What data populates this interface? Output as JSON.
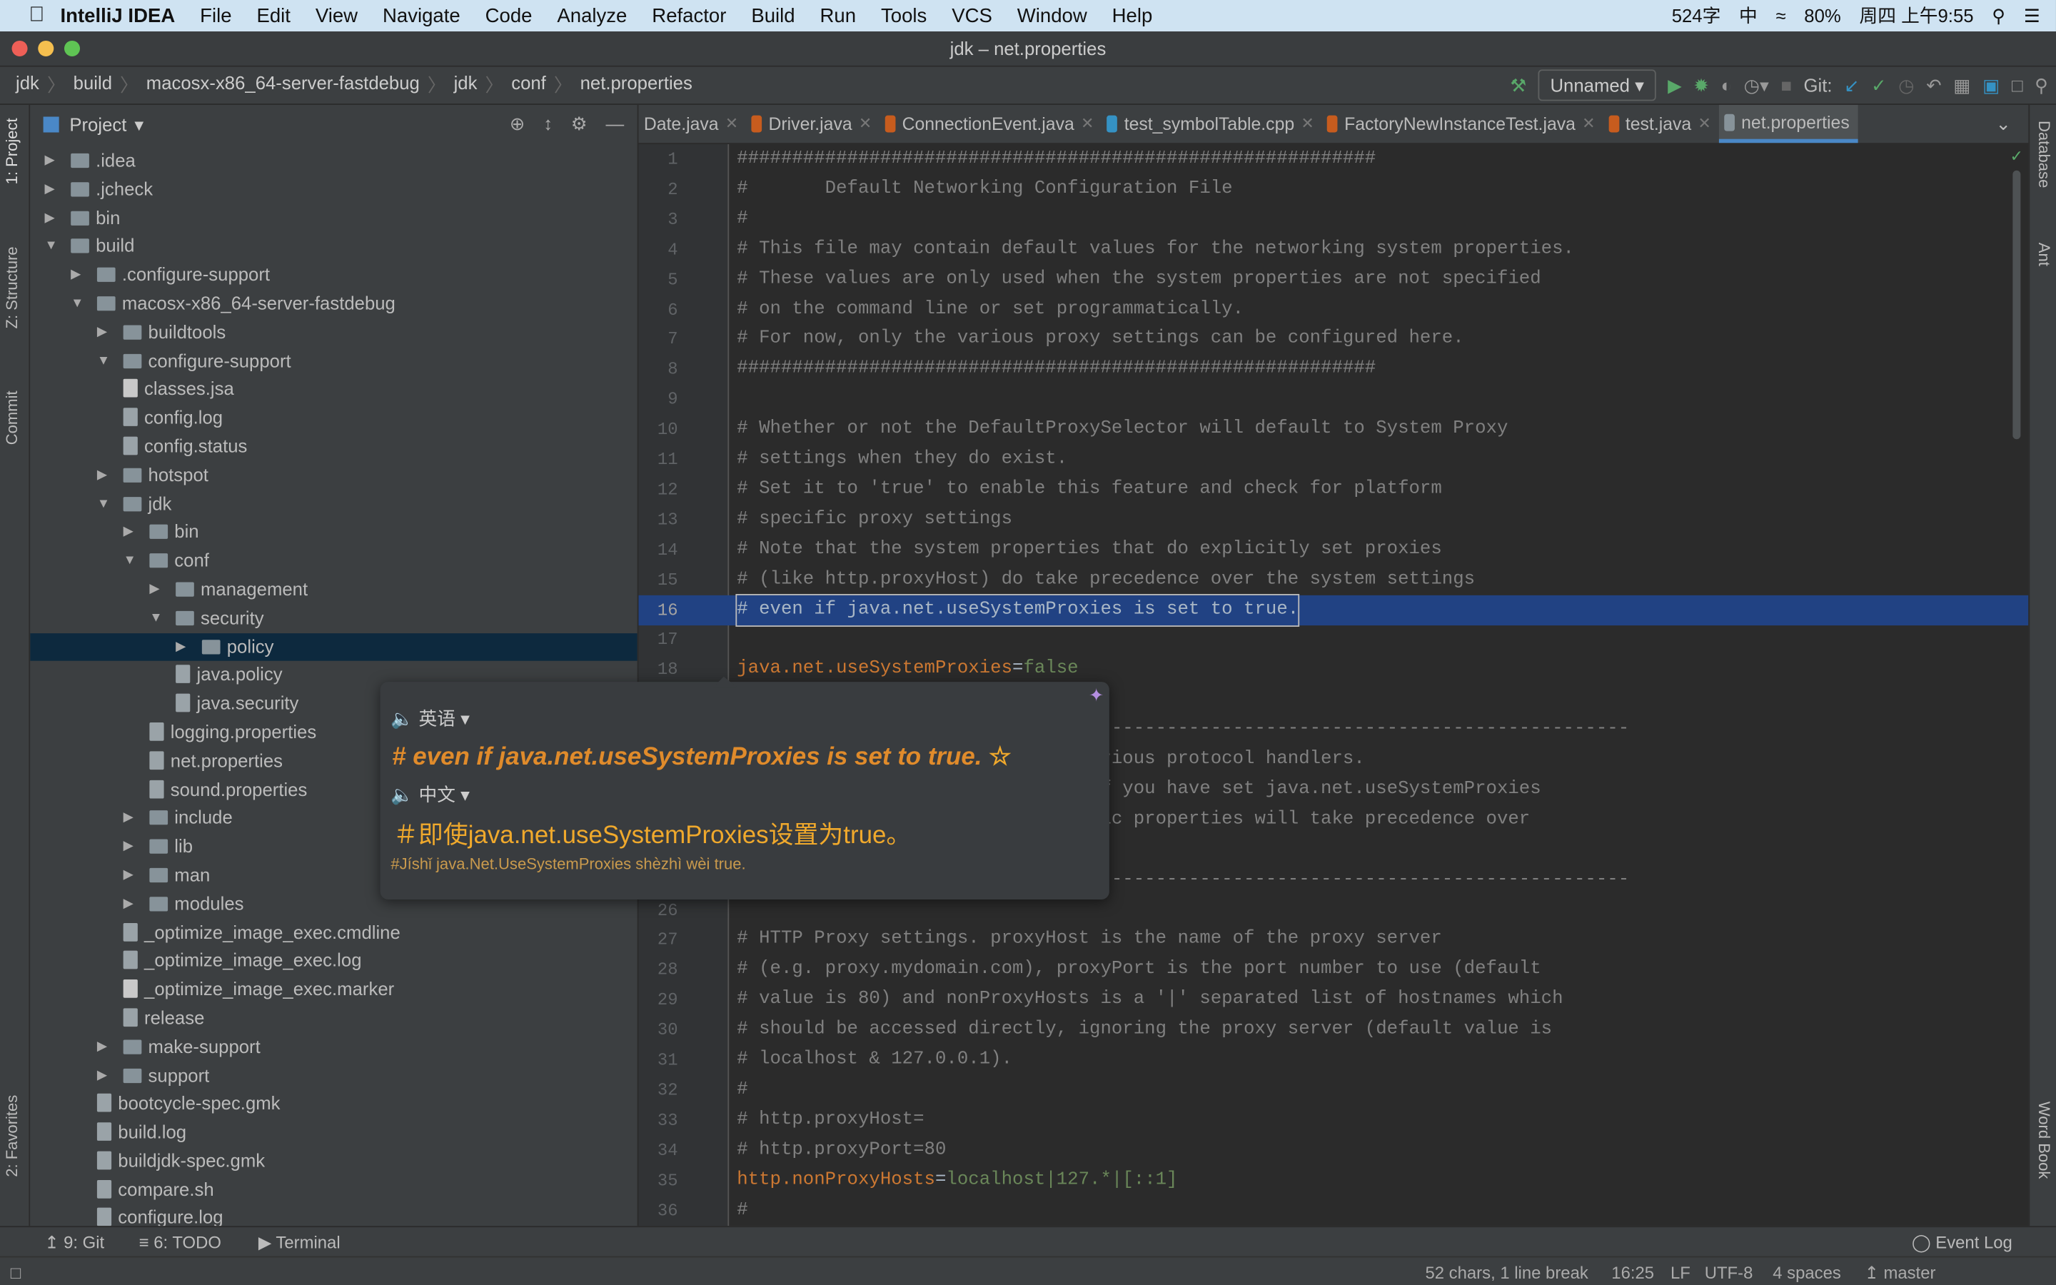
{
  "menubar": {
    "app": "IntelliJ IDEA",
    "items": [
      "File",
      "Edit",
      "View",
      "Navigate",
      "Code",
      "Analyze",
      "Refactor",
      "Build",
      "Run",
      "Tools",
      "VCS",
      "Window",
      "Help"
    ],
    "status": {
      "word_count": "524字",
      "input": "中",
      "battery": "80%",
      "clock": "周四 上午9:55"
    }
  },
  "window": {
    "title": "jdk – net.properties"
  },
  "breadcrumb": [
    "jdk",
    "build",
    "macosx-x86_64-server-fastdebug",
    "jdk",
    "conf",
    "net.properties"
  ],
  "toolbar": {
    "run_config": "Unnamed",
    "git_label": "Git:"
  },
  "project": {
    "title": "Project",
    "tree": [
      {
        "label": ".idea",
        "lvl": 1,
        "type": "folder",
        "state": "collapsed"
      },
      {
        "label": ".jcheck",
        "lvl": 1,
        "type": "folder",
        "state": "collapsed"
      },
      {
        "label": "bin",
        "lvl": 1,
        "type": "folder",
        "state": "collapsed"
      },
      {
        "label": "build",
        "lvl": 1,
        "type": "folder",
        "state": "expanded"
      },
      {
        "label": ".configure-support",
        "lvl": 2,
        "type": "folder",
        "state": "collapsed"
      },
      {
        "label": "macosx-x86_64-server-fastdebug",
        "lvl": 2,
        "type": "folder",
        "state": "expanded"
      },
      {
        "label": "buildtools",
        "lvl": 3,
        "type": "folder",
        "state": "collapsed"
      },
      {
        "label": "configure-support",
        "lvl": 3,
        "type": "folder",
        "state": "expanded"
      },
      {
        "label": "classes.jsa",
        "lvl": 4,
        "type": "file"
      },
      {
        "label": "config.log",
        "lvl": 4,
        "type": "log"
      },
      {
        "label": "config.status",
        "lvl": 4,
        "type": "log"
      },
      {
        "label": "hotspot",
        "lvl": 3,
        "type": "folder",
        "state": "collapsed"
      },
      {
        "label": "jdk",
        "lvl": 3,
        "type": "folder",
        "state": "expanded"
      },
      {
        "label": "bin",
        "lvl": 4,
        "type": "folder",
        "state": "collapsed"
      },
      {
        "label": "conf",
        "lvl": 4,
        "type": "folder",
        "state": "expanded"
      },
      {
        "label": "management",
        "lvl": 5,
        "type": "folder",
        "state": "collapsed"
      },
      {
        "label": "security",
        "lvl": 5,
        "type": "folder",
        "state": "expanded"
      },
      {
        "label": "policy",
        "lvl": 6,
        "type": "folder",
        "state": "collapsed",
        "selected": true
      },
      {
        "label": "java.policy",
        "lvl": 6,
        "type": "log"
      },
      {
        "label": "java.security",
        "lvl": 6,
        "type": "log"
      },
      {
        "label": "logging.properties",
        "lvl": 5,
        "type": "log"
      },
      {
        "label": "net.properties",
        "lvl": 5,
        "type": "log"
      },
      {
        "label": "sound.properties",
        "lvl": 5,
        "type": "log"
      },
      {
        "label": "include",
        "lvl": 4,
        "type": "folder",
        "state": "collapsed"
      },
      {
        "label": "lib",
        "lvl": 4,
        "type": "folder",
        "state": "collapsed"
      },
      {
        "label": "man",
        "lvl": 4,
        "type": "folder",
        "state": "collapsed"
      },
      {
        "label": "modules",
        "lvl": 4,
        "type": "folder",
        "state": "collapsed"
      },
      {
        "label": "_optimize_image_exec.cmdline",
        "lvl": 4,
        "type": "log"
      },
      {
        "label": "_optimize_image_exec.log",
        "lvl": 4,
        "type": "log"
      },
      {
        "label": "_optimize_image_exec.marker",
        "lvl": 4,
        "type": "file"
      },
      {
        "label": "release",
        "lvl": 4,
        "type": "log"
      },
      {
        "label": "make-support",
        "lvl": 3,
        "type": "folder",
        "state": "collapsed"
      },
      {
        "label": "support",
        "lvl": 3,
        "type": "folder",
        "state": "collapsed"
      },
      {
        "label": "bootcycle-spec.gmk",
        "lvl": 3,
        "type": "log"
      },
      {
        "label": "build.log",
        "lvl": 3,
        "type": "log"
      },
      {
        "label": "buildjdk-spec.gmk",
        "lvl": 3,
        "type": "log"
      },
      {
        "label": "compare.sh",
        "lvl": 3,
        "type": "log"
      },
      {
        "label": "configure.log",
        "lvl": 3,
        "type": "log"
      }
    ]
  },
  "left_tabs": [
    "1: Project",
    "Z: Structure",
    "Commit",
    "2: Favorites"
  ],
  "right_tabs": [
    "Database",
    "Ant",
    "Word Book"
  ],
  "tabs": [
    {
      "label": "Date.java"
    },
    {
      "label": "Driver.java"
    },
    {
      "label": "ConnectionEvent.java"
    },
    {
      "label": "test_symbolTable.cpp"
    },
    {
      "label": "FactoryNewInstanceTest.java"
    },
    {
      "label": "test.java"
    },
    {
      "label": "net.properties",
      "active": true
    }
  ],
  "editor": {
    "lines": [
      {
        "n": "1",
        "t": "##########################################################"
      },
      {
        "n": "2",
        "t": "#       Default Networking Configuration File"
      },
      {
        "n": "3",
        "t": "#"
      },
      {
        "n": "4",
        "t": "# This file may contain default values for the networking system properties."
      },
      {
        "n": "5",
        "t": "# These values are only used when the system properties are not specified"
      },
      {
        "n": "6",
        "t": "# on the command line or set programmatically."
      },
      {
        "n": "7",
        "t": "# For now, only the various proxy settings can be configured here."
      },
      {
        "n": "8",
        "t": "##########################################################"
      },
      {
        "n": "9",
        "t": ""
      },
      {
        "n": "10",
        "t": "# Whether or not the DefaultProxySelector will default to System Proxy"
      },
      {
        "n": "11",
        "t": "# settings when they do exist."
      },
      {
        "n": "12",
        "t": "# Set it to 'true' to enable this feature and check for platform"
      },
      {
        "n": "13",
        "t": "# specific proxy settings"
      },
      {
        "n": "14",
        "t": "# Note that the system properties that do explicitly set proxies"
      },
      {
        "n": "15",
        "t": "# (like http.proxyHost) do take precedence over the system settings"
      },
      {
        "n": "16",
        "t": "# even if java.net.useSystemProxies is set to true.",
        "hl": true
      },
      {
        "n": "17",
        "t": ""
      },
      {
        "n": "18",
        "k": "java.net.useSystemProxies",
        "v": "false"
      },
      {
        "n": "19",
        "t": ""
      },
      {
        "n": "20",
        "t": "                                 ------------------------------------------------"
      },
      {
        "n": "21",
        "t": "                                 rious protocol handlers."
      },
      {
        "n": "22",
        "t": "                                 f you have set java.net.useSystemProxies"
      },
      {
        "n": "23",
        "t": "                                 ic properties will take precedence over"
      },
      {
        "n": "24",
        "t": ""
      },
      {
        "n": "25",
        "t": "                                 ------------------------------------------------"
      },
      {
        "n": "26",
        "t": ""
      },
      {
        "n": "27",
        "t": "# HTTP Proxy settings. proxyHost is the name of the proxy server"
      },
      {
        "n": "28",
        "t": "# (e.g. proxy.mydomain.com), proxyPort is the port number to use (default"
      },
      {
        "n": "29",
        "t": "# value is 80) and nonProxyHosts is a '|' separated list of hostnames which"
      },
      {
        "n": "30",
        "t": "# should be accessed directly, ignoring the proxy server (default value is"
      },
      {
        "n": "31",
        "t": "# localhost & 127.0.0.1)."
      },
      {
        "n": "32",
        "t": "#"
      },
      {
        "n": "33",
        "t": "# http.proxyHost="
      },
      {
        "n": "34",
        "t": "# http.proxyPort=80"
      },
      {
        "n": "35",
        "k": "http.nonProxyHosts",
        "v": "localhost|127.*|[::1]"
      },
      {
        "n": "36",
        "t": "#"
      }
    ]
  },
  "translate_popup": {
    "source_lang": "英语",
    "source": "# even if java.net.useSystemProxies is set to true.",
    "target_lang": "中文",
    "translation": "＃即使java.net.useSystemProxies设置为true。",
    "pinyin": "#Jíshǐ java.Net.UseSystemProxies shèzhì wèi true."
  },
  "bottom_tools": {
    "git": "9: Git",
    "todo": "6: TODO",
    "terminal": "Terminal",
    "event_log": "Event Log"
  },
  "status": {
    "selection": "52 chars, 1 line break",
    "position": "16:25",
    "line_sep": "LF",
    "encoding": "UTF-8",
    "indent": "4 spaces",
    "branch": "master"
  },
  "colors": {
    "accent": "#4a88c7",
    "selection": "#214283",
    "key": "#cc7832",
    "value": "#6a8759",
    "popup_text": "#e08b2b"
  }
}
